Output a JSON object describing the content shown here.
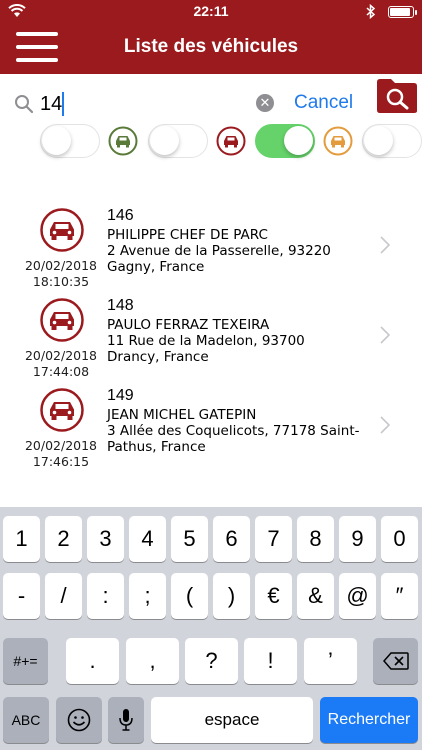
{
  "status_bar": {
    "time": "22:11"
  },
  "nav": {
    "title": "Liste des véhicules"
  },
  "search": {
    "value": "14",
    "cancel_label": "Cancel"
  },
  "filters": [
    {
      "icon": "car-green-icon",
      "color": "#5a7a3a",
      "state": "off"
    },
    {
      "icon": "car-red-icon",
      "color": "#9b1a1e",
      "state": "on"
    },
    {
      "icon": "car-orange-icon",
      "color": "#e39b3c",
      "state": "off"
    }
  ],
  "first_toggle": {
    "state": "off"
  },
  "last_toggle": {
    "state": "off"
  },
  "vehicles": [
    {
      "number": "146",
      "name": "PHILIPPE CHEF DE PARC",
      "address1": "2 Avenue de la Passerelle, 93220",
      "address2": "Gagny, France",
      "date": "20/02/2018",
      "time": "18:10:35"
    },
    {
      "number": "148",
      "name": "PAULO FERRAZ TEXEIRA",
      "address1": "11 Rue de la Madelon, 93700",
      "address2": "Drancy, France",
      "date": "20/02/2018",
      "time": "17:44:08"
    },
    {
      "number": "149",
      "name": "JEAN MICHEL GATEPIN",
      "address1": "3 Allée des Coquelicots, 77178 Saint-",
      "address2": "Pathus, France",
      "date": "20/02/2018",
      "time": "17:46:15"
    }
  ],
  "keyboard": {
    "row1": [
      "1",
      "2",
      "3",
      "4",
      "5",
      "6",
      "7",
      "8",
      "9",
      "0"
    ],
    "row2": [
      "-",
      "/",
      ":",
      ";",
      "(",
      ")",
      "€",
      "&",
      "@",
      "″"
    ],
    "row3_left": "#+=",
    "row3": [
      ".",
      ",",
      "?",
      "!",
      "’"
    ],
    "row4": {
      "abc": "ABC",
      "space": "espace",
      "search": "Rechercher"
    }
  },
  "colors": {
    "brand": "#9b1a1e",
    "accent": "#1f7aeb",
    "toggle_on": "#65d36a"
  }
}
